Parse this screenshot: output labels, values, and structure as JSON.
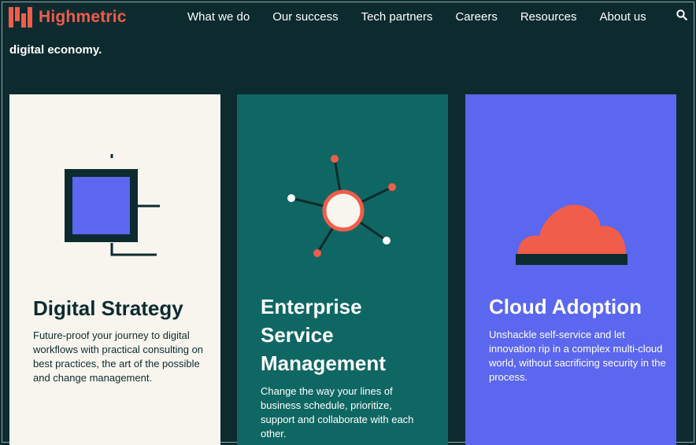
{
  "brand": {
    "name": "Highmetric"
  },
  "nav": {
    "items": [
      "What we do",
      "Our success",
      "Tech partners",
      "Careers",
      "Resources",
      "About us"
    ]
  },
  "header": {
    "search_icon": "search-icon"
  },
  "intro": {
    "tagline": "digital economy."
  },
  "cards": [
    {
      "title": "Digital Strategy",
      "description": "Future-proof your journey to digital workflows with practical consulting on best practices, the art of the possible and change management.",
      "icon": "strategy-diagram-icon",
      "background": "#f8f5ef"
    },
    {
      "title": "Enterprise Service Management",
      "description": "Change the way your lines of business schedule, prioritize, support and collaborate with each other.",
      "icon": "network-hub-icon",
      "background": "#0f6763"
    },
    {
      "title": "Cloud Adoption",
      "description": "Unshackle self-service and let innovation rip in a complex multi-cloud world, without sacrificing security in the process.",
      "icon": "cloud-icon",
      "background": "#5b67ee"
    }
  ],
  "colors": {
    "background": "#0d2b2f",
    "accent": "#f05d4a",
    "teal": "#0f6763",
    "blue": "#5b67ee",
    "cream": "#f8f5ef"
  }
}
